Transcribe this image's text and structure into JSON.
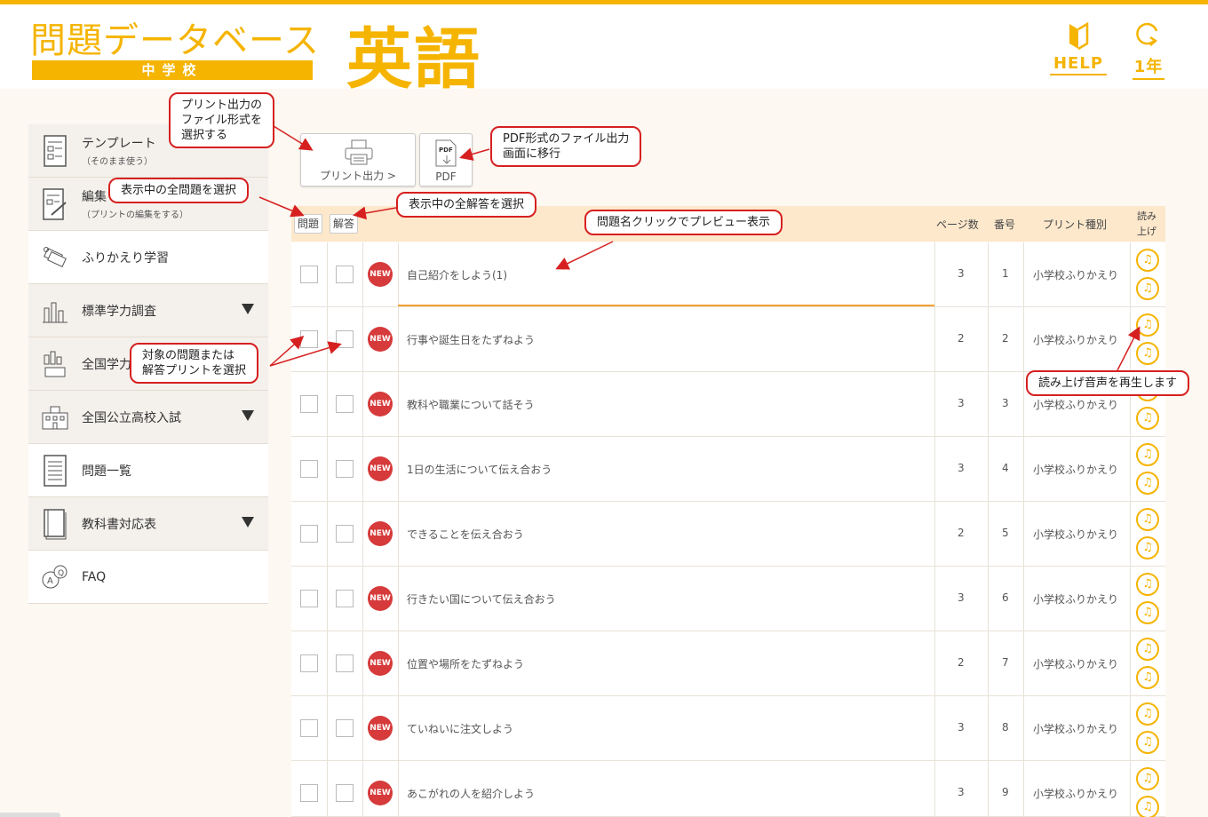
{
  "header": {
    "brand_title": "問題データベース",
    "brand_sub": "中学校",
    "subject": "英語",
    "help_label": "HELP",
    "grade_label": "1年"
  },
  "sidebar": {
    "items": [
      {
        "label": "テンプレート",
        "sub": "（そのまま使う）"
      },
      {
        "label": "編集",
        "sub": "（プリントの編集をする）"
      },
      {
        "label": "ふりかえり学習",
        "sub": ""
      },
      {
        "label": "標準学力調査",
        "sub": ""
      },
      {
        "label": "全国学力",
        "sub": ""
      },
      {
        "label": "全国公立高校入試",
        "sub": ""
      },
      {
        "label": "問題一覧",
        "sub": ""
      },
      {
        "label": "教科書対応表",
        "sub": ""
      },
      {
        "label": "FAQ",
        "sub": ""
      }
    ]
  },
  "toolbar": {
    "print_label": "プリント出力 >",
    "pdf_label": "PDF",
    "pdf_icon_text": "PDF"
  },
  "table": {
    "headers": {
      "question": "問題",
      "answer": "解答",
      "pages": "ページ数",
      "number": "番号",
      "type": "プリント種別",
      "read_line1": "読み",
      "read_line2": "上げ"
    },
    "new_badge": "NEW",
    "rows": [
      {
        "title": "自己紹介をしよう(1)",
        "pages": "3",
        "number": "1",
        "type": "小学校ふりかえり"
      },
      {
        "title": "行事や誕生日をたずねよう",
        "pages": "2",
        "number": "2",
        "type": "小学校ふりかえり"
      },
      {
        "title": "教科や職業について話そう",
        "pages": "3",
        "number": "3",
        "type": "小学校ふりかえり"
      },
      {
        "title": "1日の生活について伝え合おう",
        "pages": "3",
        "number": "4",
        "type": "小学校ふりかえり"
      },
      {
        "title": "できることを伝え合おう",
        "pages": "2",
        "number": "5",
        "type": "小学校ふりかえり"
      },
      {
        "title": "行きたい国について伝え合おう",
        "pages": "3",
        "number": "6",
        "type": "小学校ふりかえり"
      },
      {
        "title": "位置や場所をたずねよう",
        "pages": "2",
        "number": "7",
        "type": "小学校ふりかえり"
      },
      {
        "title": "ていねいに注文しよう",
        "pages": "3",
        "number": "8",
        "type": "小学校ふりかえり"
      },
      {
        "title": "あこがれの人を紹介しよう",
        "pages": "3",
        "number": "9",
        "type": "小学校ふりかえり"
      }
    ]
  },
  "annotations": {
    "print_format": [
      "プリント出力の",
      "ファイル形式を",
      "選択する"
    ],
    "pdf_move": [
      "PDF形式のファイル出力",
      "画面に移行"
    ],
    "select_all_questions": "表示中の全問題を選択",
    "select_all_answers": "表示中の全解答を選択",
    "preview": "問題名クリックでプレビュー表示",
    "select_target": [
      "対象の問題または",
      "解答プリントを選択"
    ],
    "play_audio": "読み上げ音声を再生します"
  },
  "colors": {
    "accent": "#f5b400",
    "new_badge": "#d63a3a",
    "header_row": "#fde8cc",
    "callout_border": "#d62020"
  }
}
